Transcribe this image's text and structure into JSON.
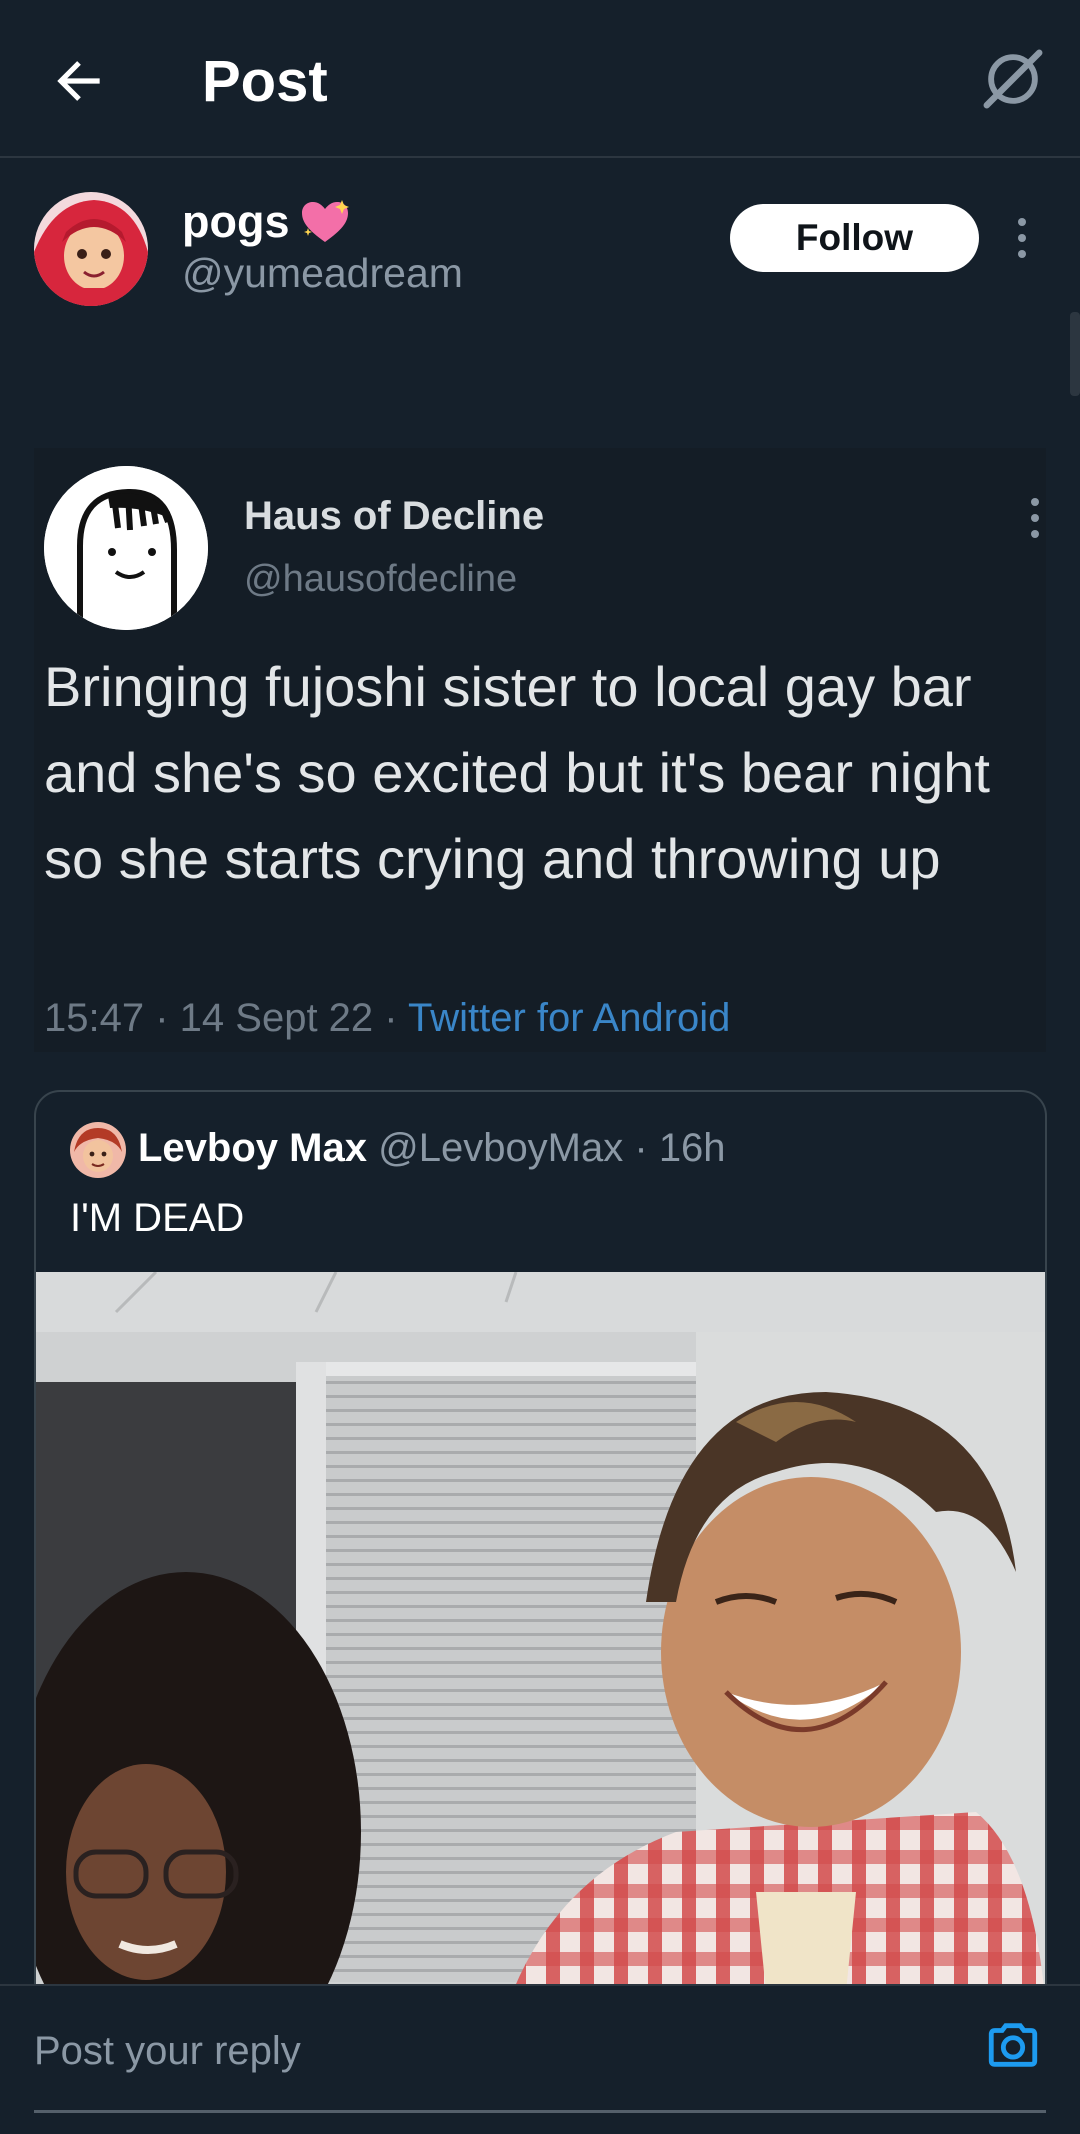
{
  "header": {
    "title": "Post",
    "back_icon": "arrow-left-icon",
    "grok_icon": "grok-icon"
  },
  "post": {
    "author": {
      "name": "pogs",
      "name_emoji": "sparkling-heart-icon",
      "handle": "@yumeadream"
    },
    "follow_label": "Follow",
    "more_icon": "more-vertical-icon"
  },
  "embedded_screenshot": {
    "name": "Haus of Decline",
    "handle": "@hausofdecline",
    "text": "Bringing fujoshi sister to local gay bar and she's so excited but it's bear night so she starts crying and throwing up",
    "time": "15:47",
    "date": "14 Sept 22",
    "source": "Twitter for Android"
  },
  "quote": {
    "name": "Levboy Max",
    "handle": "@LevboyMax",
    "age": "16h",
    "text": "I'M DEAD"
  },
  "reply": {
    "placeholder": "Post your reply",
    "camera_icon": "camera-icon"
  },
  "colors": {
    "background": "#15202b",
    "accent": "#1d9bf0",
    "secondary_text": "#8b98a5"
  }
}
